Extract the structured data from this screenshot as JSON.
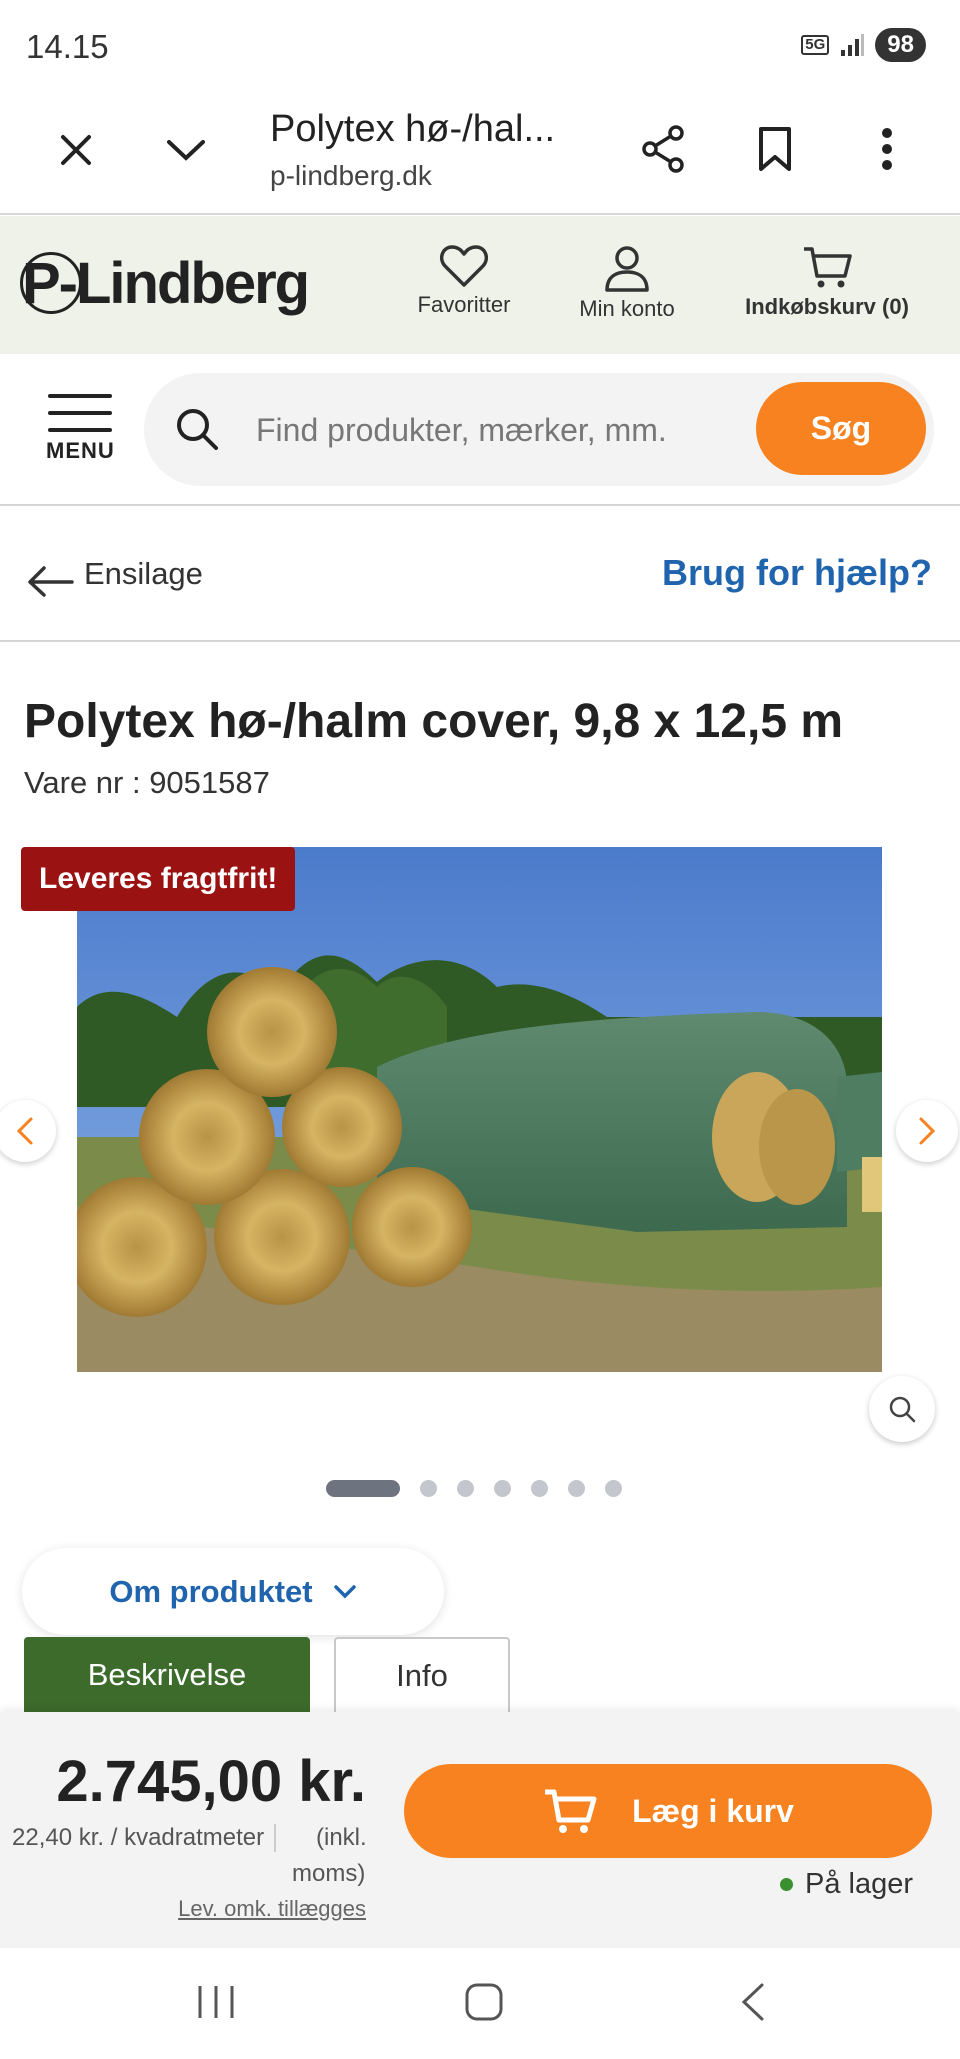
{
  "status_bar": {
    "time": "14.15",
    "network": "5G",
    "battery": "98"
  },
  "browser": {
    "title": "Polytex hø-/hal...",
    "url": "p-lindberg.dk"
  },
  "site_header": {
    "logo": "P-Lindberg",
    "favorites_label": "Favoritter",
    "account_label": "Min konto",
    "cart_label": "Indkøbskurv (0)"
  },
  "search": {
    "menu_label": "MENU",
    "placeholder": "Find produkter, mærker, mm.",
    "button_label": "Søg"
  },
  "breadcrumb": {
    "back_label": "Ensilage",
    "help_label": "Brug for hjælp?"
  },
  "product": {
    "title": "Polytex hø-/halm cover, 9,8 x 12,5 m",
    "item_number": "Vare nr : 9051587",
    "badge": "Leveres fragtfrit!",
    "image_count": 7,
    "active_image": 1
  },
  "tabs": {
    "about_label": "Om produktet",
    "description_label": "Beskrivelse",
    "info_label": "Info"
  },
  "buy_bar": {
    "price": "2.745,00 kr.",
    "unit_price": "22,40 kr. / kvadratmeter",
    "vat_line1": "(inkl.",
    "vat_line2": "moms)",
    "shipping_note": "Lev. omk. tillægges",
    "add_to_cart_label": "Læg i kurv",
    "stock_label": "På lager"
  },
  "colors": {
    "accent_orange": "#f7821f",
    "link_blue": "#1f64ad",
    "badge_red": "#9b1212",
    "tab_green": "#3d6b2c",
    "stock_green": "#3a8f2e"
  }
}
